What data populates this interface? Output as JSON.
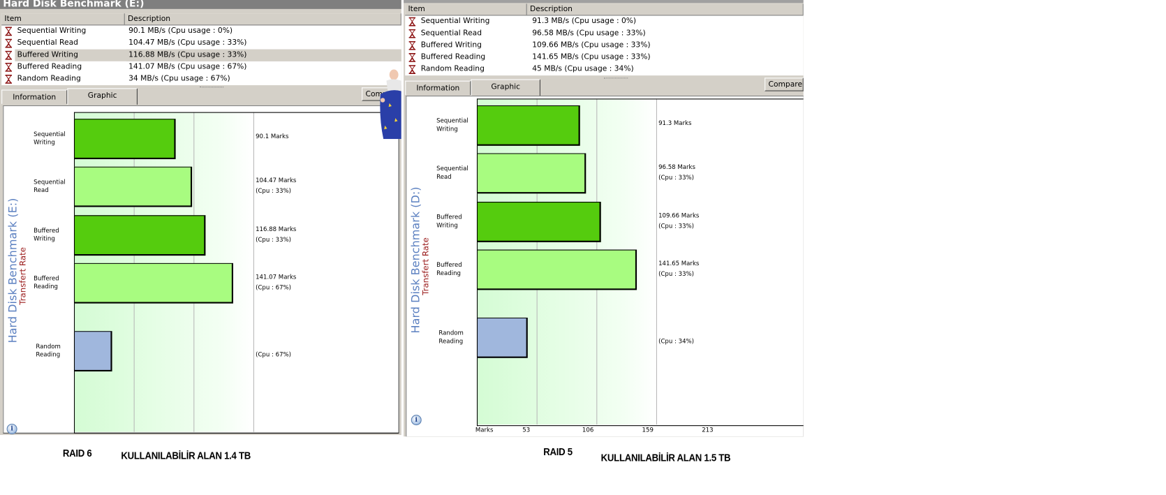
{
  "panels": [
    {
      "title": "Hard Disk Benchmark (E:)",
      "columns": [
        "Item",
        "Description"
      ],
      "rows": [
        {
          "item": "Sequential Writing",
          "description": "90.1 MB/s (Cpu usage : 0%)"
        },
        {
          "item": "Sequential Read",
          "description": "104.47 MB/s  (Cpu usage : 33%)"
        },
        {
          "item": "Buffered Writing",
          "description": "116.88 MB/s  (Cpu usage : 33%)",
          "selected": true
        },
        {
          "item": "Buffered Reading",
          "description": "141.07 MB/s  (Cpu usage : 67%)"
        },
        {
          "item": "Random Reading",
          "description": "34 MB/s  (Cpu usage : 67%)"
        }
      ],
      "tabs": [
        "Information",
        "Graphic"
      ],
      "active_tab": "Graphic",
      "compare_label": "Compare with",
      "chart_title": "Hard Disk Benchmark (E:)",
      "chart_subtitle": "Transfert Rate",
      "caption_raid": "RAID 6",
      "caption_space": "KULLANILABİLİR ALAN 1.4 TB"
    },
    {
      "title": "",
      "columns": [
        "Item",
        "Description"
      ],
      "rows": [
        {
          "item": "Sequential Writing",
          "description": "91.3 MB/s (Cpu usage : 0%)"
        },
        {
          "item": "Sequential Read",
          "description": "96.58 MB/s  (Cpu usage : 33%)"
        },
        {
          "item": "Buffered Writing",
          "description": "109.66 MB/s  (Cpu usage : 33%)"
        },
        {
          "item": "Buffered Reading",
          "description": "141.65 MB/s  (Cpu usage : 33%)"
        },
        {
          "item": "Random Reading",
          "description": "45 MB/s  (Cpu usage : 34%)"
        }
      ],
      "tabs": [
        "Information",
        "Graphic"
      ],
      "active_tab": "Graphic",
      "compare_label": "Compare with",
      "chart_title": "Hard Disk Benchmark (D:)",
      "chart_subtitle": "Transfert Rate",
      "caption_raid": "RAID 5",
      "caption_space": "KULLANILABİLİR ALAN 1.5 TB"
    }
  ],
  "colors": {
    "writing": "#55cc0e",
    "reading": "#a8fc80",
    "random": "#a0b7dd",
    "title_blue": "#5a7fc0",
    "subtitle_red": "#9a1a1a"
  },
  "chart_data": [
    {
      "type": "bar",
      "orientation": "horizontal",
      "title": "Hard Disk Benchmark (E:)",
      "subtitle": "Transfert Rate",
      "categories": [
        "Sequential Writing",
        "Sequential Read",
        "Buffered Writing",
        "Buffered Reading",
        "Random Reading"
      ],
      "category_lines": [
        [
          "Sequential",
          "Writing"
        ],
        [
          "Sequential",
          "Read"
        ],
        [
          "Buffered",
          "Writing"
        ],
        [
          "Buffered",
          "Reading"
        ],
        [
          "Random",
          "Reading"
        ]
      ],
      "values": [
        90.1,
        104.47,
        116.88,
        141.07,
        34
      ],
      "value_labels": [
        [
          "90.1 Marks"
        ],
        [
          "104.47 Marks",
          "(Cpu : 33%)"
        ],
        [
          "116.88 Marks",
          "(Cpu : 33%)"
        ],
        [
          "141.07 Marks",
          "(Cpu : 67%)"
        ],
        [
          "(Cpu : 67%)"
        ]
      ],
      "xlim": [
        0,
        285
      ],
      "gridlines": [
        53,
        106,
        159
      ],
      "xticks": []
    },
    {
      "type": "bar",
      "orientation": "horizontal",
      "title": "Hard Disk Benchmark (D:)",
      "subtitle": "Transfert Rate",
      "categories": [
        "Sequential Writing",
        "Sequential Read",
        "Buffered Writing",
        "Buffered Reading",
        "Random Reading"
      ],
      "category_lines": [
        [
          "Sequential",
          "Writing"
        ],
        [
          "Sequential",
          "Read"
        ],
        [
          "Buffered",
          "Writing"
        ],
        [
          "Buffered",
          "Reading"
        ],
        [
          "Random",
          "Reading"
        ]
      ],
      "values": [
        91.3,
        96.58,
        109.66,
        141.65,
        45
      ],
      "value_labels": [
        [
          "91.3 Marks"
        ],
        [
          "96.58 Marks",
          "(Cpu : 33%)"
        ],
        [
          "109.66 Marks",
          "(Cpu : 33%)"
        ],
        [
          "141.65 Marks",
          "(Cpu : 33%)"
        ],
        [
          "(Cpu : 34%)"
        ]
      ],
      "xlim": [
        0,
        285
      ],
      "gridlines": [
        53,
        106,
        159
      ],
      "xlabel": "Marks",
      "xticks": [
        "53",
        "106",
        "159",
        "213"
      ]
    }
  ]
}
